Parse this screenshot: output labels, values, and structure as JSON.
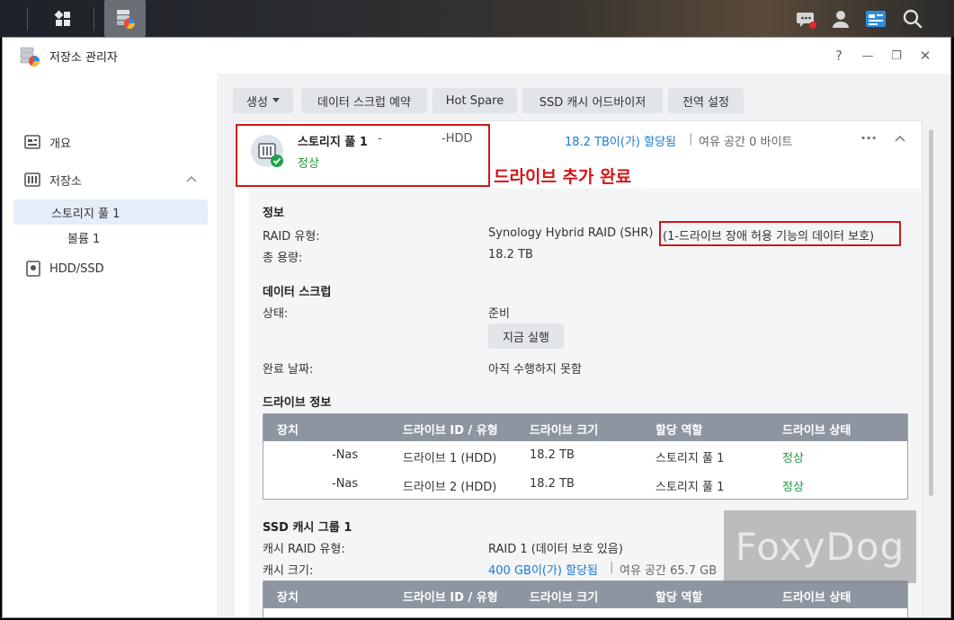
{
  "window": {
    "title": "저장소 관리자",
    "help": "?",
    "minimize": "—",
    "restore": "❐",
    "close": "✕"
  },
  "sidebar": {
    "overview": "개요",
    "storage": "저장소",
    "pool": "스토리지 풀 1",
    "volume": "볼륨 1",
    "hdd": "HDD/SSD"
  },
  "toolbar": {
    "create": "생성",
    "scrub_schedule": "데이터 스크럽 예약",
    "hot_spare": "Hot Spare",
    "ssd_advisor": "SSD 캐시 어드바이저",
    "global_settings": "전역 설정"
  },
  "pool": {
    "name": "스토리지 풀 1",
    "name_suffix": "-",
    "type": "-HDD",
    "status": "정상",
    "allocated": "18.2 TB이(가) 할당됨",
    "separator": "|",
    "free": "여유 공간 0 바이트",
    "more": "···",
    "collapse": "⌃"
  },
  "annotation": {
    "text": "드라이브 추가 완료"
  },
  "info": {
    "title": "정보",
    "raid_label": "RAID 유형:",
    "raid_value": "Synology Hybrid RAID (SHR)",
    "raid_note": "(1-드라이브 장애 허용 기능의 데이터 보호)",
    "capacity_label": "총 용량:",
    "capacity_value": "18.2 TB"
  },
  "scrub": {
    "title": "데이터 스크럽",
    "status_label": "상태:",
    "status_value": "준비",
    "run_now": "지금 실행",
    "done_label": "완료 날짜:",
    "done_value": "아직 수행하지 못함"
  },
  "drives": {
    "title": "드라이브 정보",
    "headers": [
      "장치",
      "드라이브 ID / 유형",
      "드라이브 크기",
      "할당 역할",
      "드라이브 상태"
    ],
    "rows": [
      [
        "-Nas",
        "드라이브 1 (HDD)",
        "18.2 TB",
        "스토리지 풀 1",
        "정상"
      ],
      [
        "-Nas",
        "드라이브 2 (HDD)",
        "18.2 TB",
        "스토리지 풀 1",
        "정상"
      ]
    ]
  },
  "ssd": {
    "title": "SSD 캐시 그룹 1",
    "raid_label": "캐시 RAID 유형:",
    "raid_value": "RAID 1 (데이터 보호 있음)",
    "size_label": "캐시 크기:",
    "allocated": "400 GB이(가) 할당됨",
    "separator": "|",
    "free": "여유 공간 65.7 GB",
    "headers": [
      "장치",
      "드라이브 ID / 유형",
      "드라이브 크기",
      "할당 역할",
      "드라이브 상태"
    ]
  },
  "watermark": "FoxyDog",
  "colors": {
    "accent": "#1a7bd0",
    "ok": "#1e9a3a",
    "annotation": "#d0161a"
  }
}
